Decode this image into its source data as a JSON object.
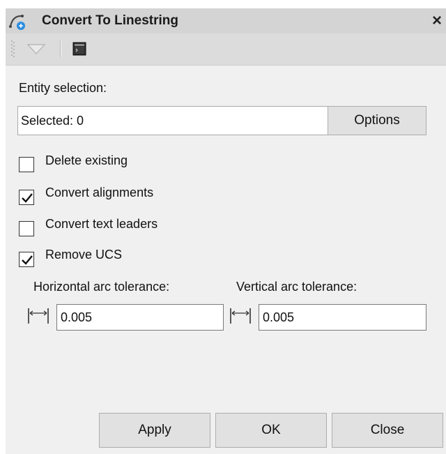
{
  "window": {
    "title": "Convert To Linestring",
    "close_glyph": "×"
  },
  "icons": {
    "app": "arc-to-line-icon",
    "dropdown": "dropdown-triangle-icon",
    "console": "console-icon",
    "tolerance": "dimension-width-icon",
    "close": "close-icon"
  },
  "entity_selection": {
    "label": "Entity selection:",
    "value": "Selected: 0",
    "options_label": "Options"
  },
  "checkboxes": [
    {
      "label": "Delete existing",
      "checked": false
    },
    {
      "label": "Convert alignments",
      "checked": true
    },
    {
      "label": "Convert text leaders",
      "checked": false
    },
    {
      "label": "Remove UCS",
      "checked": true
    }
  ],
  "tolerances": {
    "horizontal_label": "Horizontal arc tolerance:",
    "horizontal_value": "0.005",
    "vertical_label": "Vertical arc tolerance:",
    "vertical_value": "0.005"
  },
  "footer": {
    "apply_label": "Apply",
    "ok_label": "OK",
    "close_label": "Close"
  },
  "colors": {
    "titlebar": "#d4d4d4",
    "panel": "#f0f0f0",
    "accent": "#2a8de0"
  }
}
